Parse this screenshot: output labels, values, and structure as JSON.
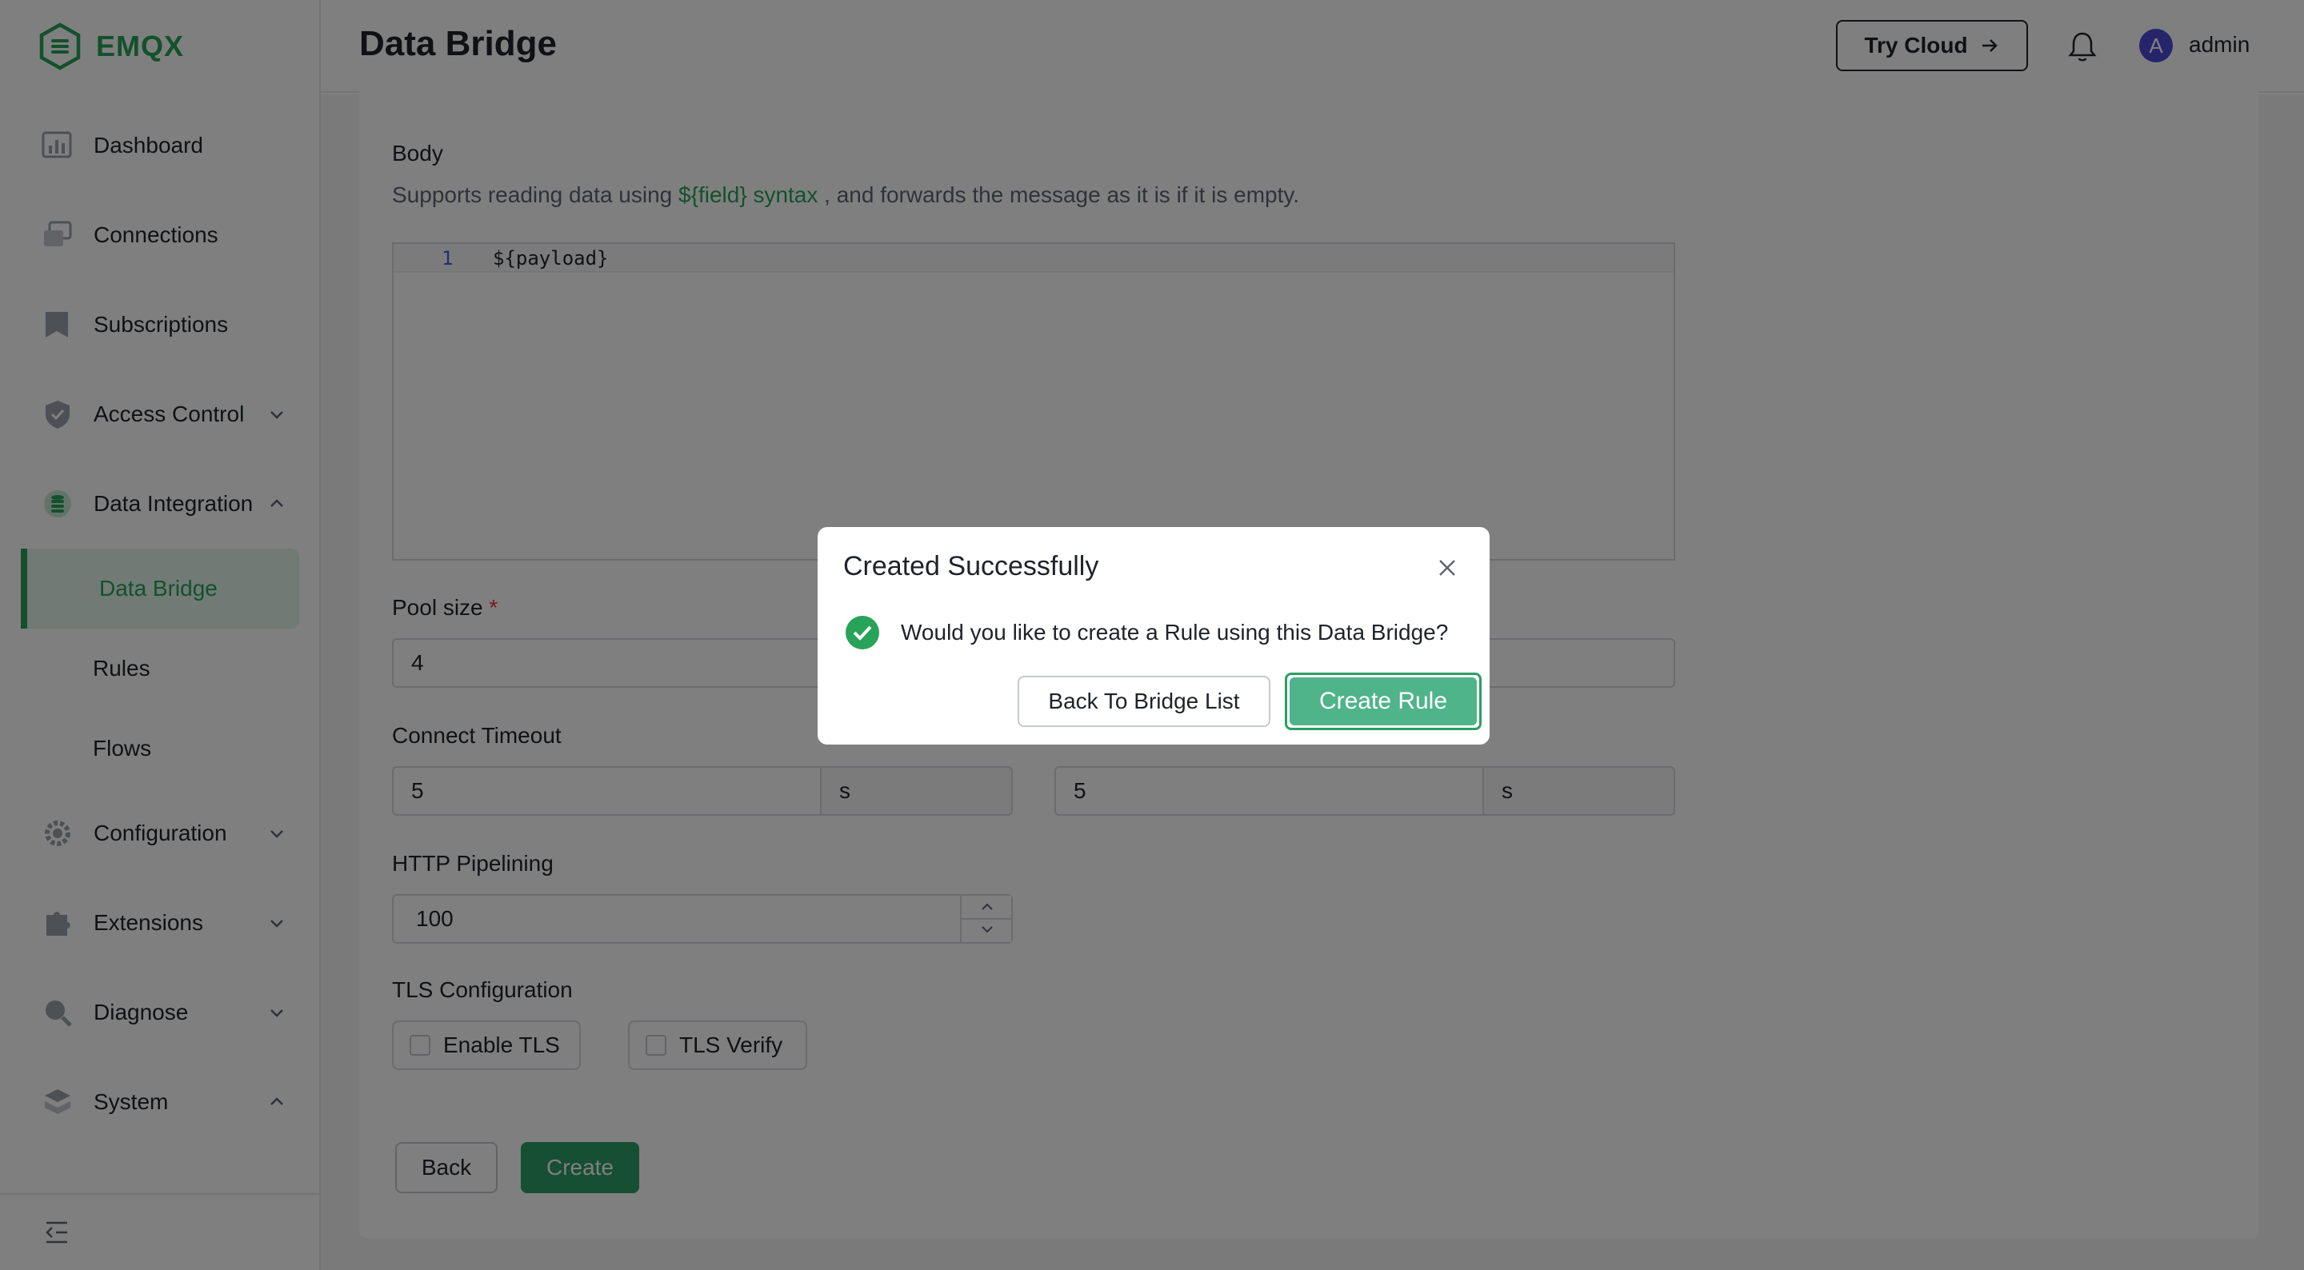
{
  "app": {
    "logo_text": "EMQX"
  },
  "sidebar": {
    "items": [
      {
        "label": "Dashboard",
        "icon": "dashboard-icon"
      },
      {
        "label": "Connections",
        "icon": "connections-icon"
      },
      {
        "label": "Subscriptions",
        "icon": "subscriptions-icon"
      },
      {
        "label": "Access Control",
        "icon": "shield-icon",
        "expandable": true
      },
      {
        "label": "Data Integration",
        "icon": "database-icon",
        "expanded": true
      }
    ],
    "subitems": [
      {
        "label": "Data Bridge",
        "active": true
      },
      {
        "label": "Rules"
      },
      {
        "label": "Flows"
      }
    ],
    "items_after": [
      {
        "label": "Configuration",
        "icon": "gear-icon"
      },
      {
        "label": "Extensions",
        "icon": "puzzle-icon"
      },
      {
        "label": "Diagnose",
        "icon": "diagnose-icon"
      },
      {
        "label": "System",
        "icon": "system-icon"
      }
    ],
    "collapse_icon": "collapse-sidebar-icon"
  },
  "header": {
    "title": "Data Bridge",
    "try_cloud": "Try Cloud",
    "user": "admin",
    "avatar_initial": "A"
  },
  "form": {
    "body_label": "Body",
    "body_hint_prefix": "Supports reading data using ",
    "body_hint_link": "${field} syntax",
    "body_hint_suffix": " , and forwards the message as it is if it is empty.",
    "editor_line_number": "1",
    "editor_code": "${payload}",
    "pool_size_label": "Pool size",
    "pool_size_required": "*",
    "pool_size_value": "4",
    "connect_timeout_label": "Connect Timeout",
    "connect_timeout_value": "5",
    "connect_timeout_unit": "s",
    "request_timeout_value": "5",
    "request_timeout_unit": "s",
    "http_pipelining_label": "HTTP Pipelining",
    "http_pipelining_value": "100",
    "tls_label": "TLS Configuration",
    "enable_tls": "Enable TLS",
    "tls_verify": "TLS Verify",
    "back_button": "Back",
    "create_button": "Create"
  },
  "dialog": {
    "title": "Created Successfully",
    "message": "Would you like to create a Rule using this Data Bridge?",
    "back_button": "Back To Bridge List",
    "create_rule_button": "Create Rule"
  },
  "colors": {
    "brand": "#27a35a",
    "primary_button": "#2c9e62",
    "dialog_primary": "#4fb48a",
    "overlay": "rgba(0,0,0,0.5)"
  }
}
